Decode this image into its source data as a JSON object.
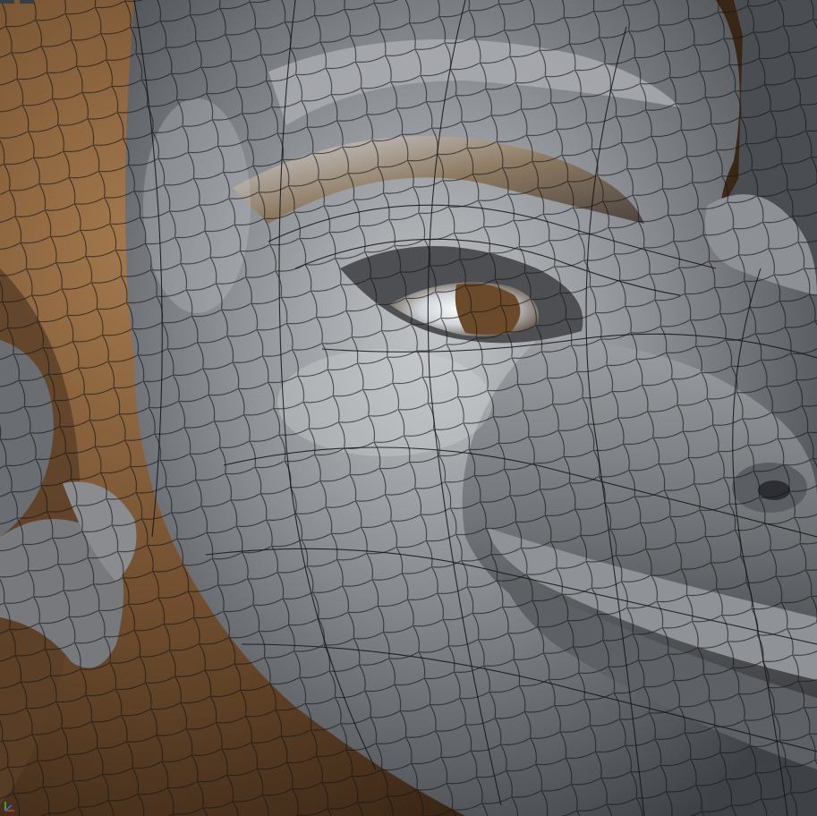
{
  "viewport": {
    "tabs": [
      {
        "label": ""
      },
      {
        "label": ""
      }
    ],
    "background_color": "#4a4d52",
    "mesh_colors": {
      "skin_light": "#b9bcbf",
      "skin_mid": "#7d8085",
      "skin_dark": "#3f4246",
      "fur_light": "#a8794e",
      "fur_dark": "#4e3520",
      "wire": "#141414"
    },
    "gizmo_icon": "axis-gizmo-icon"
  }
}
